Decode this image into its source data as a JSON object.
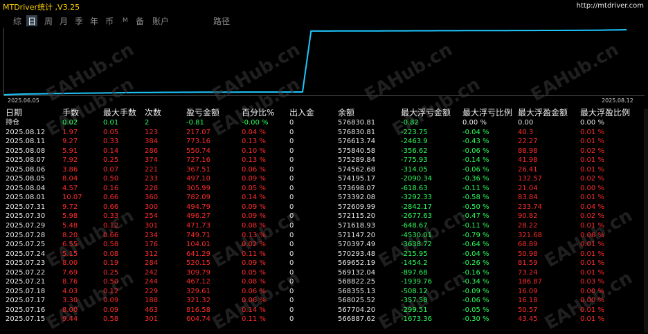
{
  "app": {
    "title": "MTDriver统计 ,V3.25",
    "url": "http://mtdriver.com"
  },
  "tabs": [
    {
      "label": "综",
      "active": false
    },
    {
      "label": "日",
      "active": true
    },
    {
      "label": "周",
      "active": false
    },
    {
      "label": "月",
      "active": false
    },
    {
      "label": "季",
      "active": false
    },
    {
      "label": "年",
      "active": false
    },
    {
      "label": "币",
      "active": false
    },
    {
      "label": "M",
      "active": false
    },
    {
      "label": "备",
      "active": false
    },
    {
      "label": "账户",
      "active": false
    },
    {
      "label": "路径",
      "active": false
    }
  ],
  "chart": {
    "start_date": "2025.06.05",
    "end_date": "2025.08.12",
    "line_color": "#1ec8ff"
  },
  "chart_data": {
    "type": "line",
    "x_start": "2025.06.05",
    "x_end": "2025.08.12",
    "series": [
      {
        "values": [
          0.0,
          0.005,
          0.01,
          0.012,
          0.014,
          0.016,
          0.018,
          0.02,
          0.022,
          0.024,
          0.026,
          0.027,
          0.028,
          0.03,
          0.032,
          0.033,
          0.034,
          0.035,
          0.036,
          0.037,
          0.037,
          0.038,
          0.038,
          0.039,
          0.039,
          0.04,
          0.04,
          0.04,
          0.041,
          0.041,
          0.041,
          0.042,
          0.042,
          0.042,
          0.043,
          0.043,
          0.98,
          0.98,
          0.98,
          0.981,
          0.981,
          0.981,
          0.982,
          0.982,
          0.982,
          0.983,
          0.983,
          0.983,
          0.984,
          0.984,
          0.984,
          0.985,
          0.985,
          0.985,
          0.986,
          0.986,
          0.986,
          0.987,
          0.987,
          0.987,
          0.988,
          0.988,
          0.988,
          0.989,
          0.989,
          0.989,
          0.99,
          0.99,
          0.991,
          0.992,
          0.994,
          0.996,
          0.998,
          1.0
        ]
      }
    ]
  },
  "watermark": "EAHub.cn",
  "table": {
    "headers": [
      "日期",
      "手数",
      "最大手数",
      "次数",
      "盈亏金额",
      "百分比%",
      "出入金",
      "余额",
      "最大浮亏金额",
      "最大浮亏比例",
      "最大浮盈金额",
      "最大浮盈比例"
    ],
    "holding": [
      "持仓",
      "0.02",
      "0.01",
      "2",
      "-0.81",
      "-0.00 %",
      "0",
      "576830.81",
      "-0.82",
      "0.00 %",
      "0.00",
      "0.00 %"
    ],
    "rows": [
      [
        "2025.08.12",
        "1.97",
        "0.05",
        "123",
        "217.07",
        "0.04 %",
        "0",
        "576830.81",
        "-223.75",
        "-0.04 %",
        "40.3",
        "0.01 %"
      ],
      [
        "2025.08.11",
        "9.27",
        "0.33",
        "384",
        "773.16",
        "0.13 %",
        "0",
        "576613.74",
        "-2463.9",
        "-0.43 %",
        "22.27",
        "0.01 %"
      ],
      [
        "2025.08.08",
        "5.91",
        "0.14",
        "286",
        "550.74",
        "0.10 %",
        "0",
        "575840.58",
        "-356.62",
        "-0.06 %",
        "88.98",
        "0.02 %"
      ],
      [
        "2025.08.07",
        "7.92",
        "0.25",
        "374",
        "727.16",
        "0.13 %",
        "0",
        "575289.84",
        "-775.93",
        "-0.14 %",
        "41.98",
        "0.01 %"
      ],
      [
        "2025.08.06",
        "3.86",
        "0.07",
        "221",
        "367.51",
        "0.06 %",
        "0",
        "574562.68",
        "-314.05",
        "-0.06 %",
        "26.41",
        "0.01 %"
      ],
      [
        "2025.08.05",
        "8.04",
        "0.50",
        "233",
        "497.10",
        "0.09 %",
        "0",
        "574195.17",
        "-2090.34",
        "-0.36 %",
        "132.57",
        "0.02 %"
      ],
      [
        "2025.08.04",
        "4.57",
        "0.16",
        "228",
        "305.99",
        "0.05 %",
        "0",
        "573698.07",
        "-618.63",
        "-0.11 %",
        "21.04",
        "0.00 %"
      ],
      [
        "2025.08.01",
        "10.07",
        "0.66",
        "360",
        "782.09",
        "0.14 %",
        "0",
        "573392.08",
        "-3292.33",
        "-0.58 %",
        "83.84",
        "0.01 %"
      ],
      [
        "2025.07.31",
        "9.72",
        "0.66",
        "300",
        "494.79",
        "0.09 %",
        "0",
        "572609.99",
        "-2842.17",
        "-0.50 %",
        "233.74",
        "0.04 %"
      ],
      [
        "2025.07.30",
        "5.98",
        "0.33",
        "254",
        "496.27",
        "0.09 %",
        "0",
        "572115.20",
        "-2677.63",
        "-0.47 %",
        "90.82",
        "0.02 %"
      ],
      [
        "2025.07.29",
        "5.48",
        "0.12",
        "301",
        "471.73",
        "0.08 %",
        "0",
        "571618.93",
        "-648.67",
        "-0.11 %",
        "28.22",
        "0.01 %"
      ],
      [
        "2025.07.28",
        "8.20",
        "0.66",
        "234",
        "749.71",
        "0.13 %",
        "0",
        "571147.20",
        "-4530.01",
        "-0.79 %",
        "321.68",
        "0.06 %"
      ],
      [
        "2025.07.25",
        "6.55",
        "0.58",
        "176",
        "104.01",
        "0.02 %",
        "0",
        "570397.49",
        "-3638.72",
        "-0.64 %",
        "68.89",
        "0.01 %"
      ],
      [
        "2025.07.24",
        "5.15",
        "0.08",
        "312",
        "641.29",
        "0.11 %",
        "0",
        "570293.48",
        "-215.95",
        "-0.04 %",
        "50.98",
        "0.01 %"
      ],
      [
        "2025.07.23",
        "8.00",
        "0.19",
        "284",
        "520.15",
        "0.09 %",
        "0",
        "569652.19",
        "-1454.2",
        "-0.26 %",
        "81.59",
        "0.01 %"
      ],
      [
        "2025.07.22",
        "7.69",
        "0.25",
        "242",
        "309.79",
        "0.05 %",
        "0",
        "569132.04",
        "-897.68",
        "-0.16 %",
        "73.24",
        "0.01 %"
      ],
      [
        "2025.07.21",
        "8.76",
        "0.50",
        "244",
        "467.12",
        "0.08 %",
        "0",
        "568822.25",
        "-1939.76",
        "-0.34 %",
        "186.87",
        "0.03 %"
      ],
      [
        "2025.07.18",
        "4.03",
        "0.12",
        "229",
        "329.61",
        "0.06 %",
        "0",
        "568355.13",
        "-508.12",
        "-0.09 %",
        "16.09",
        "0.00 %"
      ],
      [
        "2025.07.17",
        "3.30",
        "0.09",
        "188",
        "321.32",
        "0.06 %",
        "0",
        "568025.52",
        "-357.58",
        "-0.06 %",
        "16.18",
        "0.00 %"
      ],
      [
        "2025.07.16",
        "8.00",
        "0.09",
        "463",
        "816.58",
        "0.14 %",
        "0",
        "567704.20",
        "-299.51",
        "-0.05 %",
        "50.57",
        "0.01 %"
      ],
      [
        "2025.07.15",
        "9.44",
        "0.58",
        "301",
        "604.74",
        "0.11 %",
        "0",
        "566887.62",
        "-1673.36",
        "-0.30 %",
        "43.45",
        "0.01 %"
      ]
    ]
  }
}
